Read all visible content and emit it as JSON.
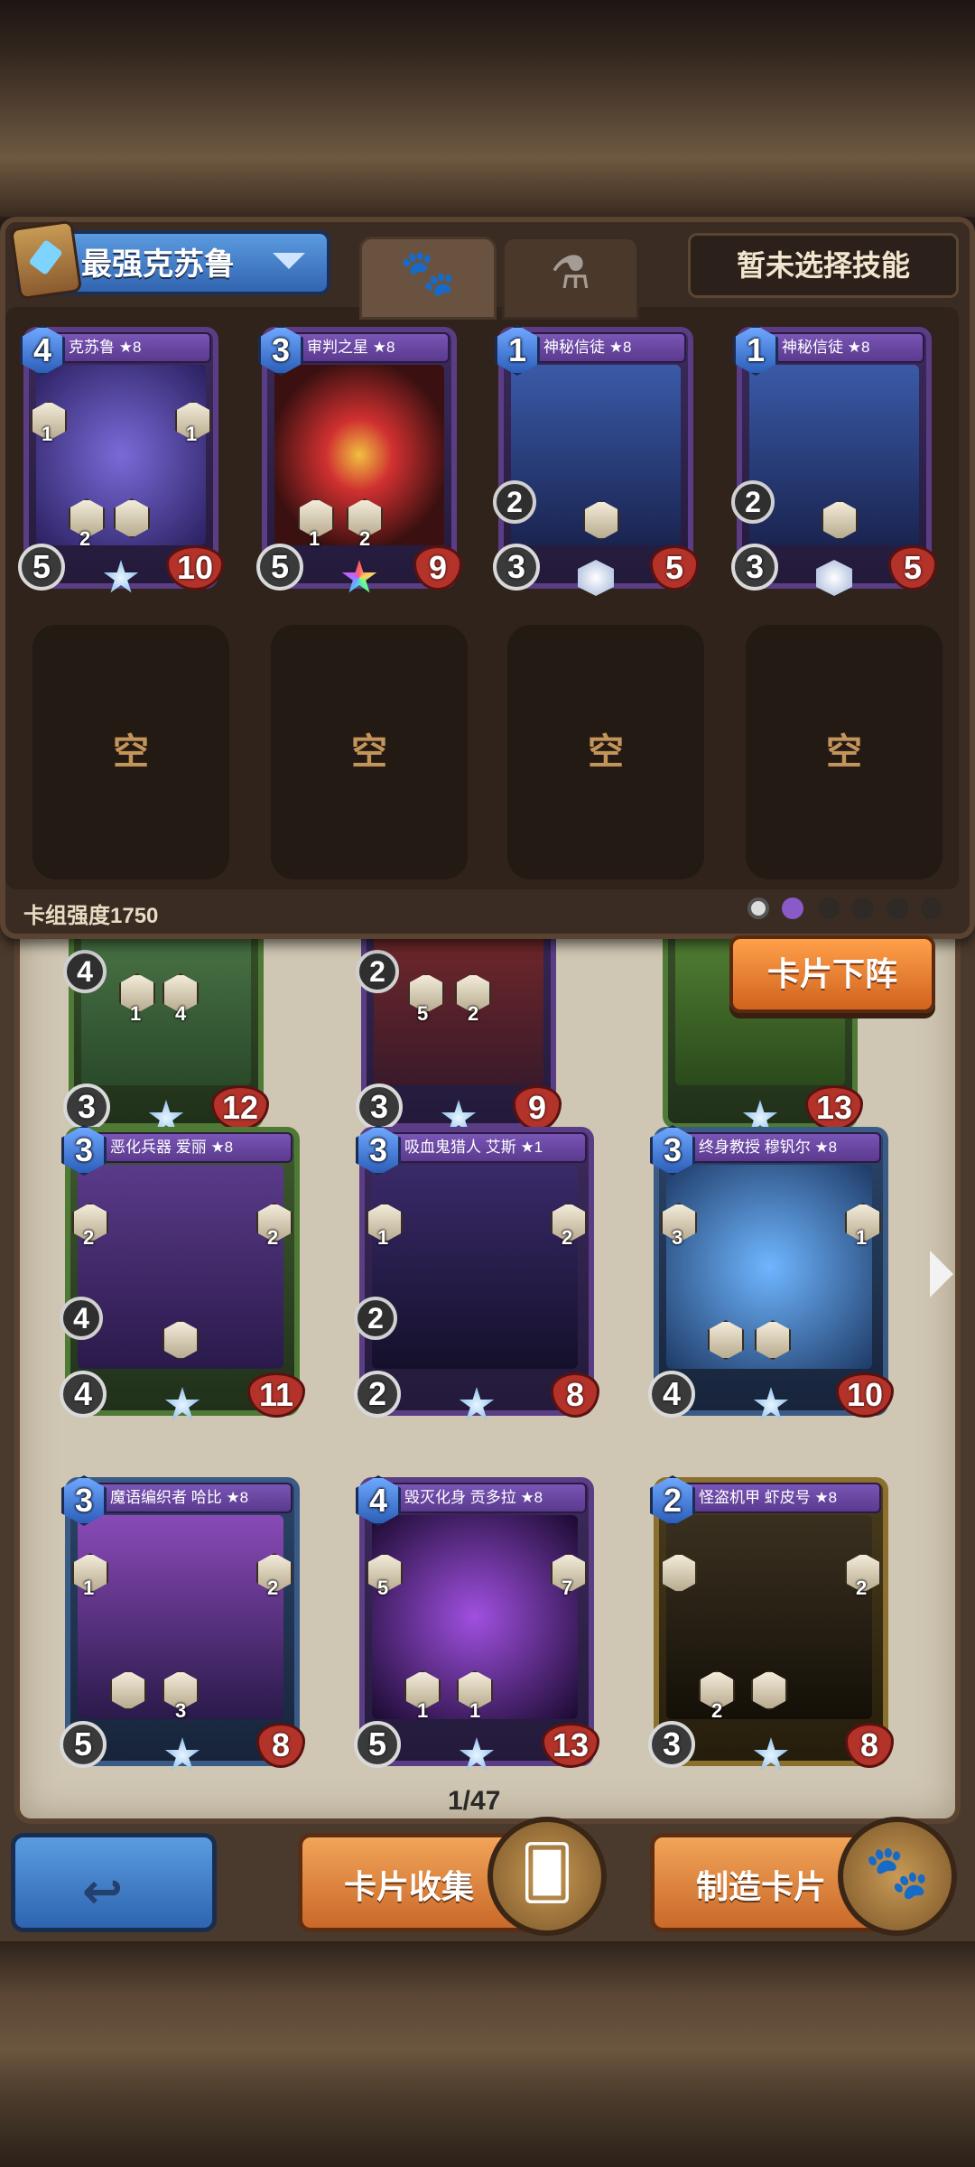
{
  "header": {
    "deck_name": "最强克苏鲁",
    "tabs": [
      {
        "icon": "paw-icon",
        "active": true
      },
      {
        "icon": "potion-icon",
        "active": false
      }
    ],
    "skill_button": "暂未选择技能"
  },
  "deck": {
    "cards": [
      {
        "name": "克苏鲁 ★8",
        "cost": "4",
        "attack": "5",
        "health": "10",
        "skills": [
          "2",
          ""
        ],
        "side": [
          "1",
          "1"
        ],
        "theme": "purple"
      },
      {
        "name": "审判之星 ★8",
        "cost": "3",
        "attack": "5",
        "health": "9",
        "skills": [
          "1",
          "2"
        ],
        "side": [],
        "theme": "purple"
      },
      {
        "name": "神秘信徒 ★8",
        "cost": "1",
        "attack": "3",
        "health": "5",
        "sub": "2",
        "skills": [
          ""
        ],
        "side": [],
        "theme": "purple"
      },
      {
        "name": "神秘信徒 ★8",
        "cost": "1",
        "attack": "3",
        "health": "5",
        "sub": "2",
        "skills": [
          ""
        ],
        "side": [],
        "theme": "purple"
      }
    ],
    "empty_label": "空",
    "strength": "卡组强度1750"
  },
  "collection": {
    "partial_row": [
      {
        "sub": "4",
        "attack": "3",
        "health": "12",
        "skills": [
          "1",
          "4"
        ],
        "theme": "green"
      },
      {
        "sub": "2",
        "attack": "3",
        "health": "9",
        "skills": [
          "5",
          "2"
        ],
        "theme": "purple"
      },
      {
        "health": "13",
        "theme": "green"
      }
    ],
    "cards": [
      {
        "name": "恶化兵器 爱丽 ★8",
        "cost": "3",
        "attack": "4",
        "sub": "4",
        "health": "11",
        "side": [
          "2",
          "2"
        ],
        "theme": "green"
      },
      {
        "name": "吸血鬼猎人 艾斯 ★1",
        "cost": "3",
        "attack": "2",
        "sub": "2",
        "health": "8",
        "side": [
          "1",
          "2"
        ],
        "theme": "purple"
      },
      {
        "name": "终身教授 穆钒尔 ★8",
        "cost": "3",
        "attack": "4",
        "health": "10",
        "side": [
          "3",
          "1"
        ],
        "theme": "blue"
      },
      {
        "name": "魔语编织者 哈比 ★8",
        "cost": "3",
        "attack": "5",
        "health": "8",
        "side": [
          "1",
          "2"
        ],
        "skills": [
          "",
          "3"
        ],
        "theme": "blue"
      },
      {
        "name": "毁灭化身 贡多拉 ★8",
        "cost": "4",
        "attack": "5",
        "health": "13",
        "side": [
          "5",
          "7"
        ],
        "skills": [
          "1",
          "1"
        ],
        "theme": "purple"
      },
      {
        "name": "怪盗机甲 虾皮号 ★8",
        "cost": "2",
        "attack": "3",
        "health": "8",
        "side": [
          "",
          "2"
        ],
        "skills": [
          "2",
          ""
        ],
        "theme": "gold"
      }
    ],
    "unload_button": "卡片下阵",
    "page": "1/47"
  },
  "footer": {
    "back_icon": "back-arrow-icon",
    "collection_button": "卡片收集",
    "craft_button": "制造卡片"
  },
  "colors": {
    "accent_blue": "#3264b0",
    "accent_orange": "#d0631f",
    "panel_brown": "#3a2c22"
  }
}
